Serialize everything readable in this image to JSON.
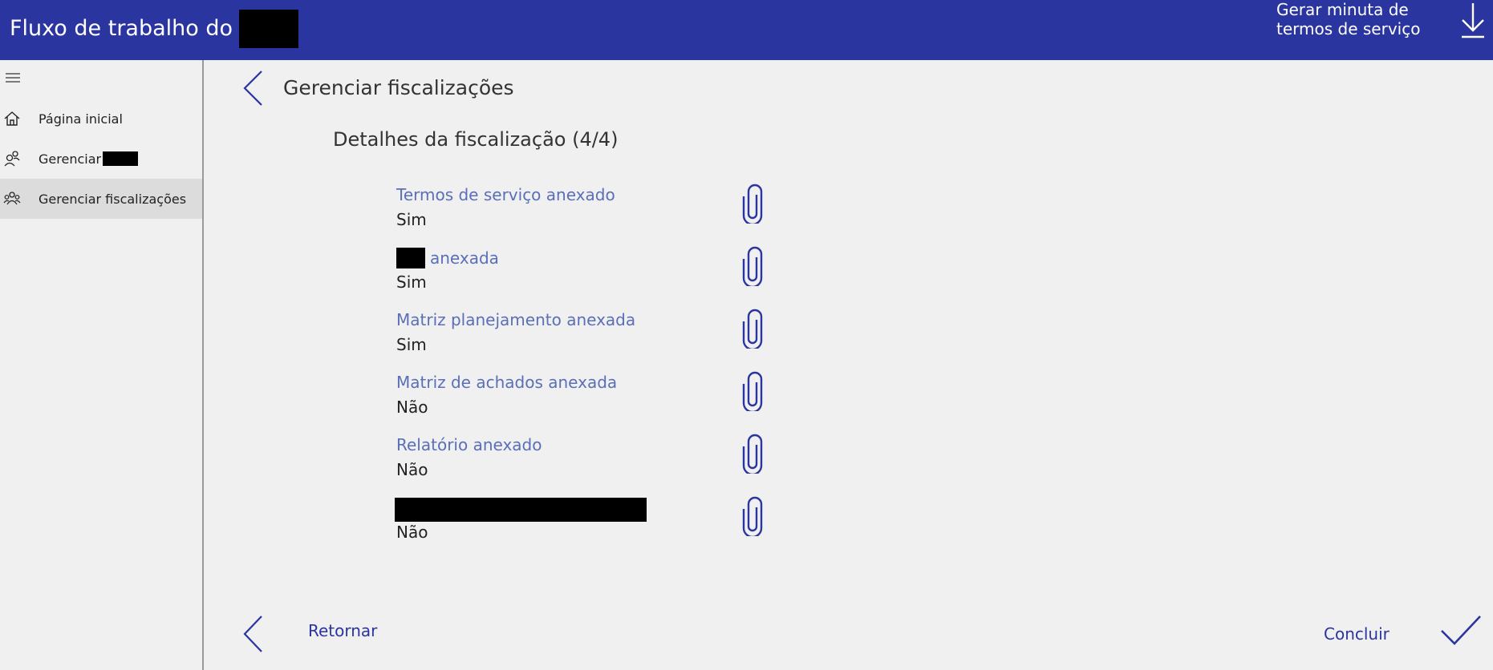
{
  "header": {
    "title": "Fluxo de trabalho do",
    "generate_line1": "Gerar minuta de",
    "generate_line2": "termos de serviço"
  },
  "sidebar": {
    "items": [
      {
        "label": "Página inicial",
        "icon": "home-icon"
      },
      {
        "label": "Gerenciar",
        "icon": "person-icon"
      },
      {
        "label": "Gerenciar fiscalizações",
        "icon": "people-icon",
        "active": true
      }
    ]
  },
  "main": {
    "page_title": "Gerenciar fiscalizações",
    "section_title": "Detalhes da fiscalização (4/4)",
    "fields": [
      {
        "label": "Termos de serviço anexado",
        "value": "Sim"
      },
      {
        "label": "anexada",
        "value": "Sim"
      },
      {
        "label": "Matriz planejamento anexada",
        "value": "Sim"
      },
      {
        "label": "Matriz de achados anexada",
        "value": "Não"
      },
      {
        "label": "Relatório anexado",
        "value": "Não"
      },
      {
        "label": "",
        "value": "Não"
      }
    ]
  },
  "footer": {
    "back_label": "Retornar",
    "done_label": "Concluir"
  },
  "colors": {
    "header_bg": "#2b35a0",
    "label_text": "#5a6fb8",
    "accent": "#2b35a0"
  }
}
